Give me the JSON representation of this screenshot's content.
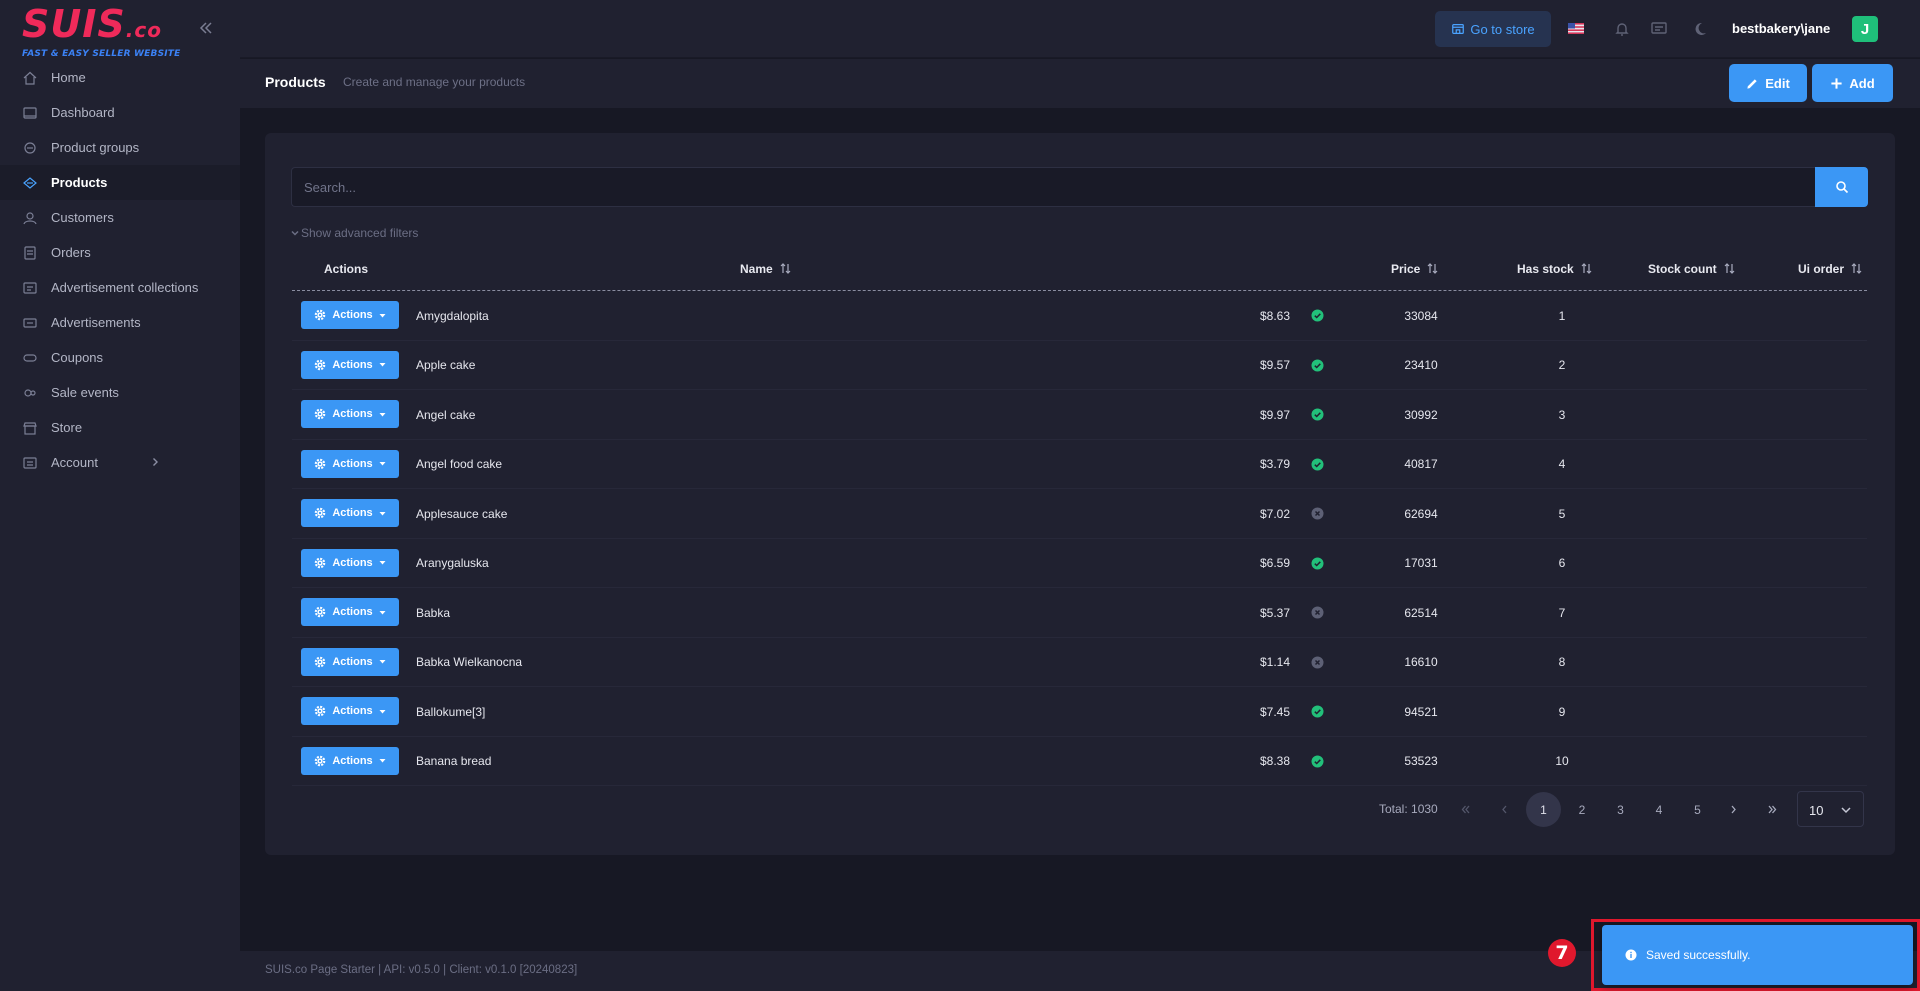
{
  "brand": {
    "logo_main": "SUIS",
    "logo_suffix": ".co",
    "logo_tagline": "FAST & EASY SELLER WEBSITE"
  },
  "sidebar": {
    "items": [
      {
        "label": "Home",
        "icon": "home-icon"
      },
      {
        "label": "Dashboard",
        "icon": "dashboard-icon"
      },
      {
        "label": "Product groups",
        "icon": "product-groups-icon"
      },
      {
        "label": "Products",
        "icon": "products-icon",
        "active": true
      },
      {
        "label": "Customers",
        "icon": "customers-icon"
      },
      {
        "label": "Orders",
        "icon": "orders-icon"
      },
      {
        "label": "Advertisement collections",
        "icon": "ad-collections-icon"
      },
      {
        "label": "Advertisements",
        "icon": "advertisements-icon"
      },
      {
        "label": "Coupons",
        "icon": "coupons-icon"
      },
      {
        "label": "Sale events",
        "icon": "sale-events-icon"
      },
      {
        "label": "Store",
        "icon": "store-icon"
      },
      {
        "label": "Account",
        "icon": "account-icon",
        "has_submenu": true
      }
    ]
  },
  "topbar": {
    "go_to_store": "Go to store",
    "user": "bestbakery\\jane",
    "avatar_initial": "J"
  },
  "header": {
    "title": "Products",
    "subtitle": "Create and manage your products",
    "edit_label": "Edit",
    "add_label": "Add"
  },
  "search": {
    "placeholder": "Search...",
    "advanced_filters": "Show advanced filters"
  },
  "table": {
    "columns": {
      "actions": "Actions",
      "name": "Name",
      "price": "Price",
      "has_stock": "Has stock",
      "stock_count": "Stock count",
      "ui_order": "Ui order"
    },
    "action_label": "Actions",
    "rows": [
      {
        "name": "Amygdalopita",
        "price": "$8.63",
        "has_stock": true,
        "stock_count": "33084",
        "ui_order": "1"
      },
      {
        "name": "Apple cake",
        "price": "$9.57",
        "has_stock": true,
        "stock_count": "23410",
        "ui_order": "2"
      },
      {
        "name": "Angel cake",
        "price": "$9.97",
        "has_stock": true,
        "stock_count": "30992",
        "ui_order": "3"
      },
      {
        "name": "Angel food cake",
        "price": "$3.79",
        "has_stock": true,
        "stock_count": "40817",
        "ui_order": "4"
      },
      {
        "name": "Applesauce cake",
        "price": "$7.02",
        "has_stock": false,
        "stock_count": "62694",
        "ui_order": "5"
      },
      {
        "name": "Aranygaluska",
        "price": "$6.59",
        "has_stock": true,
        "stock_count": "17031",
        "ui_order": "6"
      },
      {
        "name": "Babka",
        "price": "$5.37",
        "has_stock": false,
        "stock_count": "62514",
        "ui_order": "7"
      },
      {
        "name": "Babka Wielkanocna",
        "price": "$1.14",
        "has_stock": false,
        "stock_count": "16610",
        "ui_order": "8"
      },
      {
        "name": "Ballokume[3]",
        "price": "$7.45",
        "has_stock": true,
        "stock_count": "94521",
        "ui_order": "9"
      },
      {
        "name": "Banana bread",
        "price": "$8.38",
        "has_stock": true,
        "stock_count": "53523",
        "ui_order": "10"
      }
    ]
  },
  "pagination": {
    "total": "Total: 1030",
    "pages": [
      "1",
      "2",
      "3",
      "4",
      "5"
    ],
    "current": "1",
    "per_page": "10"
  },
  "footer": {
    "text": "SUIS.co Page Starter | API: v0.5.0 | Client: v0.1.0 [20240823]"
  },
  "toast": {
    "message": "Saved successfully.",
    "badge": "7"
  },
  "colors": {
    "accent": "#3b97f5",
    "in_stock": "#22c07a",
    "out_of_stock": "#5d6075",
    "brand": "#ef2a5a",
    "highlight": "#e0182d"
  }
}
